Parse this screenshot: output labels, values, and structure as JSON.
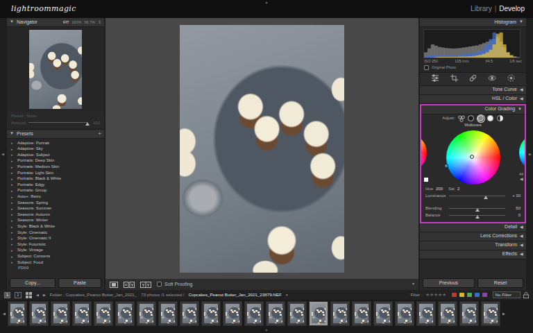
{
  "app": {
    "logo": "lightroommagic",
    "separator": "|",
    "modules": [
      {
        "label": "Library",
        "selected": false
      },
      {
        "label": "Develop",
        "selected": true
      }
    ]
  },
  "panel_arrows": {
    "top": "▲",
    "bottom": "▼",
    "left": "◀",
    "right": "▶"
  },
  "navigator": {
    "title": "Navigator",
    "collapse": "▼",
    "zoom": [
      {
        "label": "FIT",
        "selected": true
      },
      {
        "label": "100%",
        "selected": false
      },
      {
        "label": "66.7%",
        "selected": false
      },
      {
        "label": "⇕",
        "selected": false
      }
    ]
  },
  "preset_amount": {
    "preset": "Preset : None",
    "amount": "Amount",
    "value": "100",
    "level": 1,
    "disabled": true
  },
  "presets": {
    "title": "Presets",
    "collapse": "▼",
    "add": "+",
    "expander": "▸",
    "items": [
      {
        "label": "Adaptive: Portrait",
        "kind": "group"
      },
      {
        "label": "Adaptive: Sky",
        "kind": "group"
      },
      {
        "label": "Adaptive: Subject",
        "kind": "group"
      },
      {
        "label": "Portraits: Deep Skin",
        "kind": "group"
      },
      {
        "label": "Portraits: Medium Skin",
        "kind": "group"
      },
      {
        "label": "Portraits: Light Skin",
        "kind": "group"
      },
      {
        "label": "Portraits: Black & White",
        "kind": "group"
      },
      {
        "label": "Portraits: Edgy",
        "kind": "group"
      },
      {
        "label": "Portraits: Group",
        "kind": "group"
      },
      {
        "label": "Auto+: Retro",
        "kind": "group"
      },
      {
        "label": "Seasons: Spring",
        "kind": "group"
      },
      {
        "label": "Seasons: Summer",
        "kind": "group"
      },
      {
        "label": "Seasons: Autumn",
        "kind": "group"
      },
      {
        "label": "Seasons: Winter",
        "kind": "group"
      },
      {
        "label": "Style: Black & White",
        "kind": "group"
      },
      {
        "label": "Style: Cinematic",
        "kind": "group"
      },
      {
        "label": "Style: Cinematic II",
        "kind": "group"
      },
      {
        "label": "Style: Futuristic",
        "kind": "group"
      },
      {
        "label": "Style: Vintage",
        "kind": "group"
      },
      {
        "label": "Subject: Concerts",
        "kind": "group"
      },
      {
        "label": "Subject: Food",
        "kind": "group"
      },
      {
        "label": "PD69",
        "kind": "preset"
      }
    ]
  },
  "left_buttons": [
    {
      "label": "Copy..."
    },
    {
      "label": "Paste"
    }
  ],
  "toolbar": {
    "soft_proofing": {
      "label": "Soft Proofing",
      "checked": false
    },
    "menu": "▾"
  },
  "histogram": {
    "title": "Histogram",
    "collapse": "▼",
    "series": [
      {
        "color": "#8c8c8c",
        "values": [
          20,
          35,
          50,
          45,
          40,
          38,
          36,
          35,
          34,
          35,
          36,
          38,
          40,
          42,
          44,
          46,
          50,
          55,
          60,
          65,
          70,
          75,
          60,
          40,
          20,
          10,
          5,
          2
        ]
      },
      {
        "color": "#3f6fd8",
        "values": [
          5,
          8,
          10,
          10,
          9,
          8,
          8,
          8,
          8,
          9,
          10,
          12,
          14,
          16,
          18,
          20,
          25,
          35,
          50,
          70,
          95,
          80,
          40,
          20,
          10,
          5,
          2,
          0
        ]
      },
      {
        "color": "#e8c23a",
        "values": [
          0,
          0,
          0,
          2,
          3,
          3,
          3,
          3,
          3,
          3,
          4,
          4,
          4,
          5,
          6,
          8,
          10,
          14,
          20,
          30,
          50,
          90,
          95,
          50,
          20,
          8,
          2,
          0
        ]
      }
    ],
    "readouts": [
      "ISO 250",
      "105 mm",
      "f/4.5",
      "1/6 sec"
    ],
    "original_photo": {
      "label": "Original Photo",
      "checked": false
    }
  },
  "tools": [
    {
      "kind": "edit",
      "selected": true
    },
    {
      "kind": "crop",
      "selected": false
    },
    {
      "kind": "heal",
      "selected": false
    },
    {
      "kind": "redeye",
      "selected": false
    },
    {
      "kind": "mask",
      "selected": false
    }
  ],
  "sections_above": [
    {
      "label": "Tone Curve",
      "collapse": "◀"
    },
    {
      "label": "HSL / Color",
      "collapse": "◀"
    }
  ],
  "color_grading": {
    "title": "Color Grading",
    "collapse": "▼",
    "adjust": "Adjust:",
    "modes": [
      {
        "kind": "three-way",
        "selected": false
      },
      {
        "kind": "shadows",
        "selected": false
      },
      {
        "kind": "midtones",
        "selected": true
      },
      {
        "kind": "highlights",
        "selected": false
      },
      {
        "kind": "global",
        "selected": false
      }
    ],
    "region": "Midtones",
    "hue_label": "Hue",
    "hue": "200",
    "sat_label": "Sat",
    "sat": "2",
    "hue_level": 0.556,
    "sat_level": 0.02,
    "side_value": "44",
    "side_glyph": "◀",
    "sliders": [
      {
        "label": "Luminance",
        "value": "+ 30",
        "level": 0.65
      },
      {
        "label": "Blending",
        "value": "50",
        "level": 0.5
      },
      {
        "label": "Balance",
        "value": "0",
        "level": 0.5
      }
    ]
  },
  "sections_below": [
    {
      "label": "Detail",
      "collapse": "◀"
    },
    {
      "label": "Lens Corrections",
      "collapse": "◀"
    },
    {
      "label": "Transform",
      "collapse": "◀"
    },
    {
      "label": "Effects",
      "collapse": "◀"
    }
  ],
  "right_buttons": [
    {
      "label": "Previous"
    },
    {
      "label": "Reset"
    }
  ],
  "filmstrip": {
    "screens": [
      {
        "label": "1",
        "selected": true
      },
      {
        "label": "2",
        "selected": false
      }
    ],
    "prev": "◀",
    "next": "▶",
    "folder": "Folder : Cupcakes_Peanut Butter_Jan_2021_",
    "count": "73 photos /1 selected /",
    "file": "Cupcakes_Peanut Butter_Jan_2021_23879.NEF",
    "file_menu": "▾",
    "filter_label": "Filter :",
    "star_glyph": "★",
    "stars": [
      {
        "filled": false
      },
      {
        "filled": false
      },
      {
        "filled": false
      },
      {
        "filled": false
      },
      {
        "filled": false
      }
    ],
    "labels": [
      {
        "color": "#c0392b"
      },
      {
        "color": "#d4b83a"
      },
      {
        "color": "#4caf50"
      },
      {
        "color": "#3b6fc4"
      },
      {
        "color": "#8e44ad"
      }
    ],
    "filter_menu": "No Filter",
    "scroll_left": "◀",
    "scroll_right": "▶",
    "thumbnails": [
      {
        "selected": false
      },
      {
        "selected": false
      },
      {
        "selected": false
      },
      {
        "selected": false
      },
      {
        "selected": false
      },
      {
        "selected": false
      },
      {
        "selected": false
      },
      {
        "selected": false
      },
      {
        "selected": false
      },
      {
        "selected": false
      },
      {
        "selected": false
      },
      {
        "selected": false
      },
      {
        "selected": false
      },
      {
        "selected": false
      },
      {
        "selected": true
      },
      {
        "selected": false
      },
      {
        "selected": false
      },
      {
        "selected": false
      },
      {
        "selected": false
      },
      {
        "selected": false
      },
      {
        "selected": false
      },
      {
        "selected": false
      },
      {
        "selected": false
      }
    ]
  }
}
